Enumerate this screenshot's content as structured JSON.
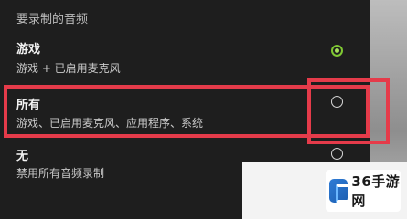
{
  "settings": {
    "section_heading": "要录制的音频",
    "options": [
      {
        "title": "游戏",
        "description": "游戏 + 已启用麦克风",
        "selected": true
      },
      {
        "title": "所有",
        "description": "游戏、已启用麦克风、应用程序、系统",
        "selected": false
      },
      {
        "title": "无",
        "description": "禁用所有音频录制",
        "selected": false
      }
    ]
  },
  "watermark": {
    "text": "36手游网"
  },
  "colors": {
    "background": "#1e1e1e",
    "radio_selected": "#7fc832",
    "highlight": "#e53b4a"
  }
}
